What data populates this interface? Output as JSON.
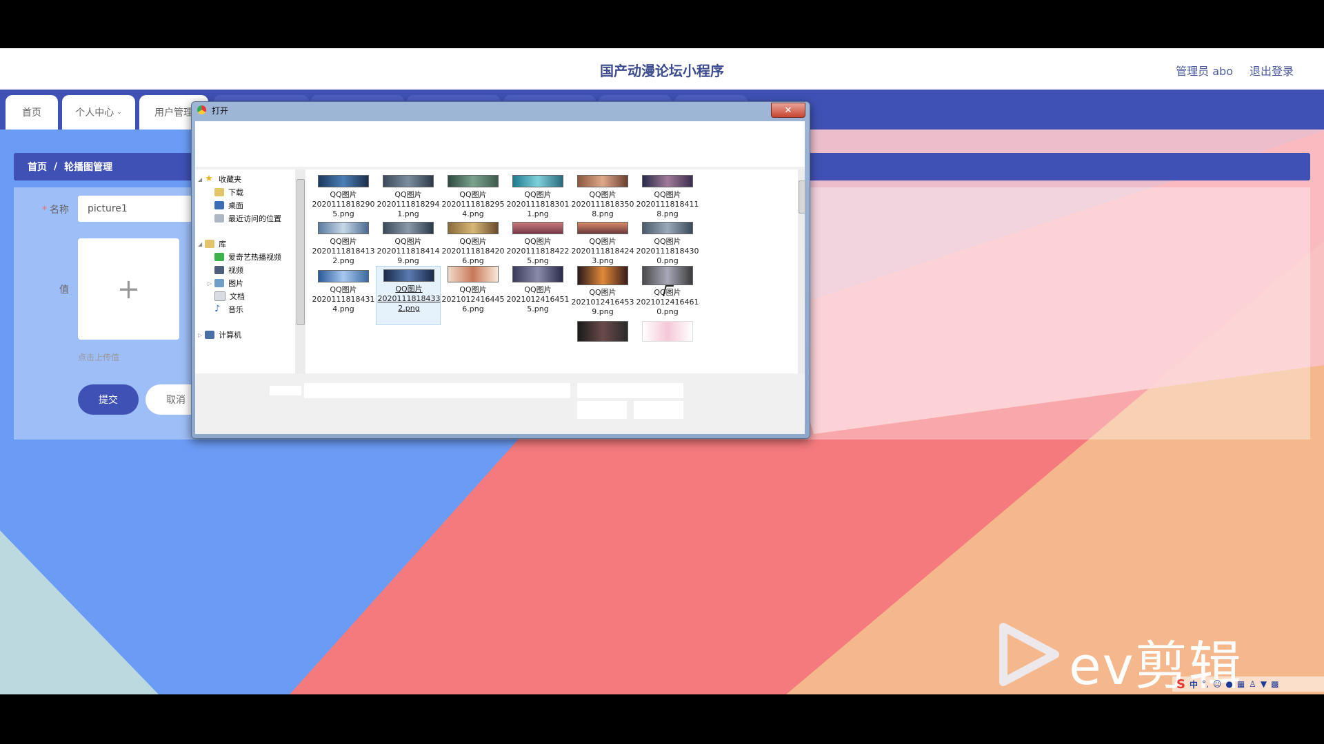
{
  "header": {
    "title": "国产动漫论坛小程序",
    "admin": "管理员 abo",
    "logout": "退出登录"
  },
  "nav": {
    "tabs": [
      "首页",
      "个人中心",
      "用户管理"
    ]
  },
  "breadcrumb": {
    "home": "首页",
    "separator": "/",
    "current": "轮播图管理"
  },
  "form": {
    "name_label": "名称",
    "name_value": "picture1",
    "value_label": "值",
    "upload_icon": "plus-icon",
    "upload_glyph": "+",
    "hint": "点击上传值",
    "submit": "提交",
    "cancel": "取消"
  },
  "dialog": {
    "title": "打开",
    "close": "✕",
    "nav_items": [
      {
        "label": "收藏夹",
        "icon": "star-icon"
      },
      {
        "label": "下载",
        "icon": "download-folder-icon"
      },
      {
        "label": "桌面",
        "icon": "desktop-icon"
      },
      {
        "label": "最近访问的位置",
        "icon": "recent-places-icon"
      },
      {
        "label": "库",
        "icon": "library-icon"
      },
      {
        "label": "爱奇艺热播视频",
        "icon": "iqiyi-icon"
      },
      {
        "label": "视频",
        "icon": "video-library-icon"
      },
      {
        "label": "图片",
        "icon": "pictures-library-icon"
      },
      {
        "label": "文档",
        "icon": "documents-library-icon"
      },
      {
        "label": "音乐",
        "icon": "music-library-icon"
      },
      {
        "label": "计算机",
        "icon": "computer-icon"
      }
    ],
    "files": [
      {
        "l1": "QQ图片",
        "l2": "2020111818290",
        "l3": "5.png"
      },
      {
        "l1": "QQ图片",
        "l2": "2020111818294",
        "l3": "1.png"
      },
      {
        "l1": "QQ图片",
        "l2": "2020111818295",
        "l3": "4.png"
      },
      {
        "l1": "QQ图片",
        "l2": "2020111818301",
        "l3": "1.png"
      },
      {
        "l1": "QQ图片",
        "l2": "2020111818350",
        "l3": "8.png"
      },
      {
        "l1": "QQ图片",
        "l2": "2020111818411",
        "l3": "8.png"
      },
      {
        "l1": "QQ图片",
        "l2": "2020111818413",
        "l3": "2.png"
      },
      {
        "l1": "QQ图片",
        "l2": "2020111818414",
        "l3": "9.png"
      },
      {
        "l1": "QQ图片",
        "l2": "2020111818420",
        "l3": "6.png"
      },
      {
        "l1": "QQ图片",
        "l2": "2020111818422",
        "l3": "5.png"
      },
      {
        "l1": "QQ图片",
        "l2": "2020111818424",
        "l3": "3.png"
      },
      {
        "l1": "QQ图片",
        "l2": "2020111818430",
        "l3": "0.png"
      },
      {
        "l1": "QQ图片",
        "l2": "2020111818431",
        "l3": "4.png"
      },
      {
        "l1": "QQ图片",
        "l2": "2020111818433",
        "l3": "2.png"
      },
      {
        "l1": "QQ图片",
        "l2": "2021012416445",
        "l3": "6.png"
      },
      {
        "l1": "QQ图片",
        "l2": "2021012416451",
        "l3": "5.png"
      },
      {
        "l1": "QQ图片",
        "l2": "2021012416453",
        "l3": "9.png"
      },
      {
        "l1": "QQ图片",
        "l2": "2021012416461",
        "l3": "0.png"
      },
      {
        "l1": "",
        "l2": "",
        "l3": ""
      },
      {
        "l1": "",
        "l2": "",
        "l3": ""
      }
    ],
    "selected_index": 13
  },
  "watermark": {
    "text": "ev剪辑",
    "icon": "play-triangle-icon"
  },
  "tray": {
    "ime": "中",
    "icons": [
      "sogou-icon",
      "punctuation-icon",
      "emoji-icon",
      "mic-icon",
      "keyboard-icon",
      "user-icon",
      "shirt-icon",
      "grid-icon"
    ]
  },
  "colors": {
    "primary": "#3f51b5",
    "bg_blue": "#6b9cf5",
    "bg_red": "#f47a7e",
    "bg_peach": "#f5b88d",
    "bg_pink": "#fbc2c8"
  }
}
